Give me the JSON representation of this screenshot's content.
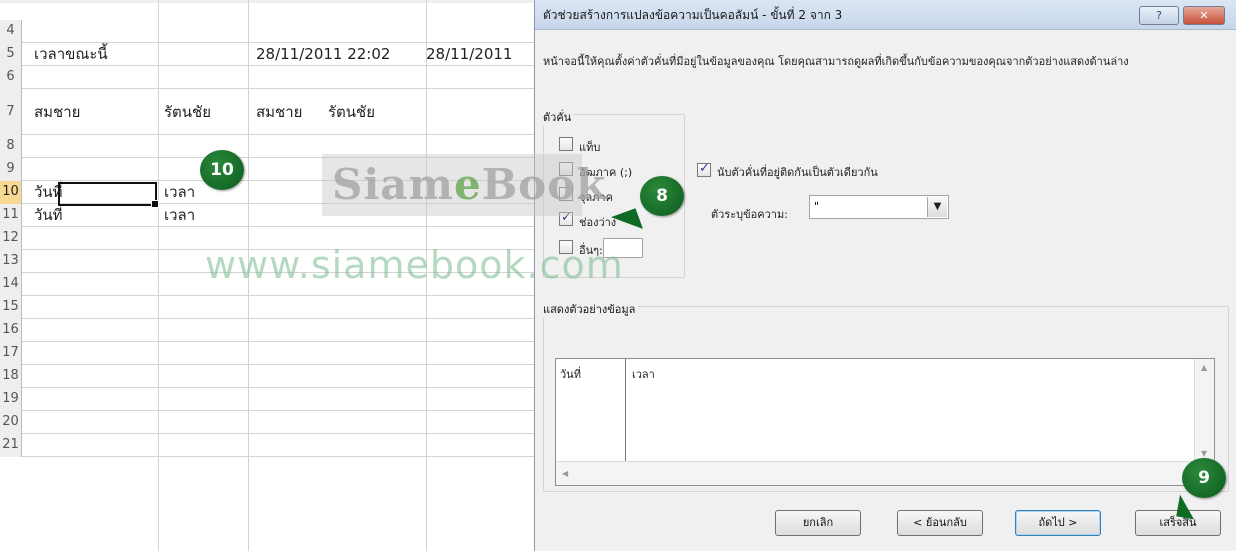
{
  "sheet": {
    "rows": [
      {
        "num": "4",
        "cells": []
      },
      {
        "num": "5",
        "cells": [
          {
            "col": "A",
            "text": "เวลาขณะนี้"
          },
          {
            "col": "C",
            "text": "28/11/2011 22:02"
          },
          {
            "col": "D",
            "text": "28/11/2011"
          }
        ]
      },
      {
        "num": "6",
        "cells": []
      },
      {
        "num": "7",
        "cells": [
          {
            "col": "A",
            "text": "สมชาย"
          },
          {
            "col": "B",
            "text": "รัตนชัย"
          },
          {
            "col": "C",
            "text": "สมชาย"
          },
          {
            "col": "C2",
            "text": "รัตนชัย"
          }
        ]
      },
      {
        "num": "8",
        "cells": []
      },
      {
        "num": "9",
        "cells": []
      },
      {
        "num": "10",
        "cells": [
          {
            "col": "A",
            "text": "วันที่"
          },
          {
            "col": "B",
            "text": "เวลา"
          }
        ]
      },
      {
        "num": "11",
        "cells": [
          {
            "col": "A",
            "text": "วันที่"
          },
          {
            "col": "B",
            "text": "เวลา"
          }
        ]
      },
      {
        "num": "12",
        "cells": []
      },
      {
        "num": "13",
        "cells": []
      },
      {
        "num": "14",
        "cells": []
      },
      {
        "num": "15",
        "cells": []
      },
      {
        "num": "16",
        "cells": []
      },
      {
        "num": "17",
        "cells": []
      },
      {
        "num": "18",
        "cells": []
      },
      {
        "num": "19",
        "cells": []
      },
      {
        "num": "20",
        "cells": []
      },
      {
        "num": "21",
        "cells": []
      }
    ],
    "active_row": "10"
  },
  "watermark": {
    "logo_pre": "Siam",
    "logo_e": "e",
    "logo_post": "Book",
    "url": "www.siamebook.com"
  },
  "callouts": {
    "c10": "10",
    "c8": "8",
    "c9": "9"
  },
  "dialog": {
    "title": "ตัวช่วยสร้างการแปลงข้อความเป็นคอลัมน์ - ขั้นที่ 2 จาก 3",
    "help_icon": "?",
    "close_icon": "✕",
    "instructions": "หน้าจอนี้ให้คุณตั้งค่าตัวคั่นที่มีอยู่ในข้อมูลของคุณ โดยคุณสามารถดูผลที่เกิดขึ้นกับข้อความของคุณจากตัวอย่างแสดงด้านล่าง",
    "delimiters_label": "ตัวคั่น",
    "delimiters": [
      {
        "label": "แท็บ",
        "checked": false
      },
      {
        "label": "อัฒภาค (;)",
        "checked": false
      },
      {
        "label": "จุลภาค",
        "checked": false
      },
      {
        "label": "ช่องว่าง",
        "checked": true
      },
      {
        "label": "อื่นๆ:",
        "checked": false
      }
    ],
    "other_value": "",
    "consecutive_label": "นับตัวคั่นที่อยู่ติดกันเป็นตัวเดียวกัน",
    "consecutive_checked": true,
    "qualifier_label": "ตัวระบุข้อความ:",
    "qualifier_value": "\"",
    "preview_label": "แสดงตัวอย่างข้อมูล",
    "preview_cols": [
      "วันที่",
      "เวลา"
    ],
    "buttons": {
      "cancel": "ยกเลิก",
      "back": "< ย้อนกลับ",
      "next": "ถัดไป >",
      "finish": "เสร็จสิ้น"
    }
  }
}
